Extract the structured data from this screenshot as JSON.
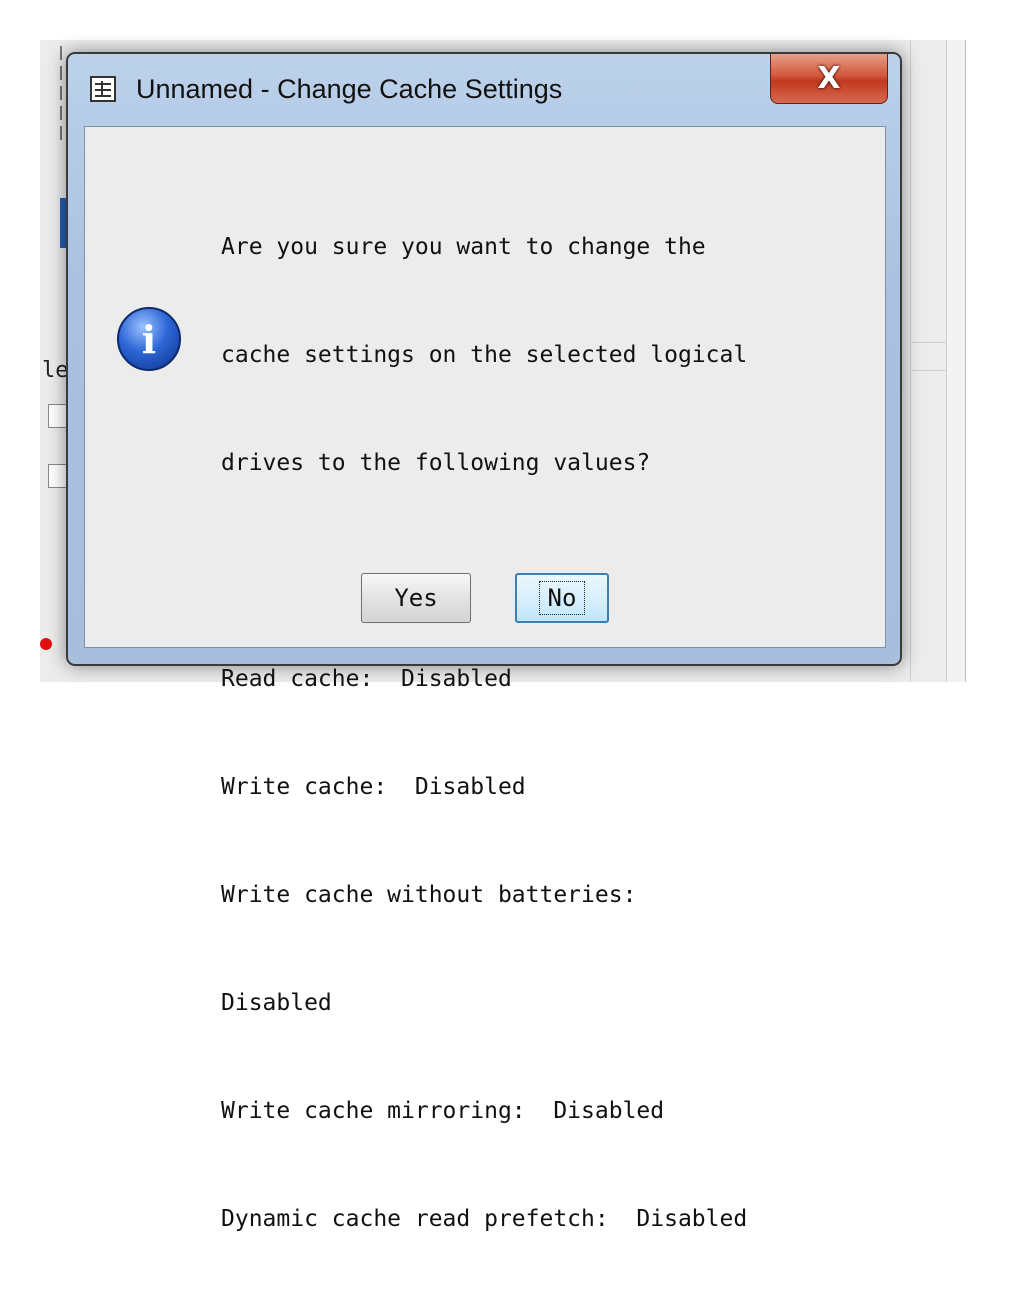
{
  "background_app": {
    "partial_label": "le"
  },
  "dialog": {
    "title": "Unnamed - Change Cache Settings",
    "close_glyph": "X",
    "icon": "information-icon",
    "message_lines": [
      "Are you sure you want to change the",
      "cache settings on the selected logical",
      "drives to the following values?",
      "",
      "Read cache:  Disabled",
      "Write cache:  Disabled",
      "Write cache without batteries:",
      "Disabled",
      "Write cache mirroring:  Disabled",
      "Dynamic cache read prefetch:  Disabled"
    ],
    "buttons": {
      "yes": "Yes",
      "no": "No"
    }
  },
  "colors": {
    "dialog_frame": "#a9c1df",
    "close_button": "#c0381f",
    "info_icon": "#2d66d6",
    "client_bg": "#ececec"
  }
}
